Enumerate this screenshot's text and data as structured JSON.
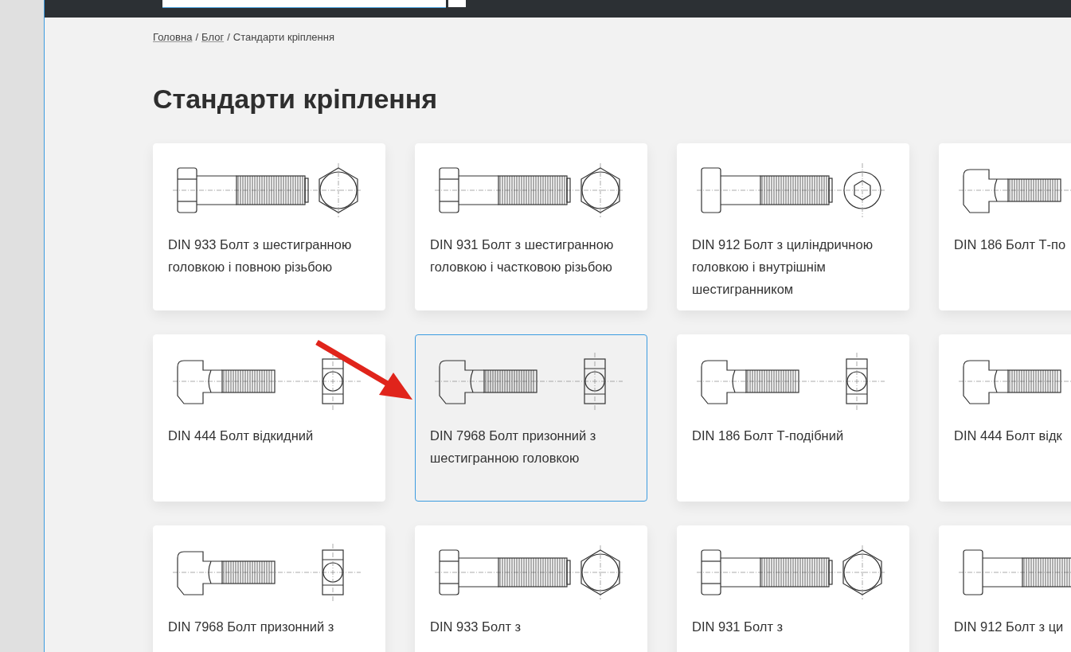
{
  "breadcrumb": {
    "links": [
      "Головна",
      "Блог"
    ],
    "separator": "/",
    "current": "Стандарти кріплення"
  },
  "title": "Стандарти кріплення",
  "cards": [
    {
      "kind": "hex",
      "text": "DIN 933 Болт з шестигранною головкою і повною різьбою",
      "selected": false
    },
    {
      "kind": "hex",
      "text": "DIN 931 Болт з шестигранною головкою і частковою різьбою",
      "selected": false
    },
    {
      "kind": "socket",
      "text": "DIN 912 Болт з циліндричною головкою і внутрішнім шестигранником",
      "selected": false
    },
    {
      "kind": "tee",
      "text": "DIN 186 Болт Т-по",
      "selected": false
    },
    {
      "kind": "tee",
      "text": "DIN 444 Болт відкидний",
      "selected": false
    },
    {
      "kind": "tee",
      "text": "DIN 7968 Болт призонний з шестигранною головкою",
      "selected": true
    },
    {
      "kind": "tee",
      "text": "DIN 186 Болт Т-подібний",
      "selected": false
    },
    {
      "kind": "tee",
      "text": "DIN 444 Болт відк",
      "selected": false
    },
    {
      "kind": "tee",
      "text": "DIN 7968 Болт призонний з",
      "selected": false
    },
    {
      "kind": "hex",
      "text": "DIN 933 Болт з",
      "selected": false
    },
    {
      "kind": "hex",
      "text": "DIN 931 Болт з",
      "selected": false
    },
    {
      "kind": "socket",
      "text": "DIN 912 Болт з ци",
      "selected": false
    }
  ]
}
